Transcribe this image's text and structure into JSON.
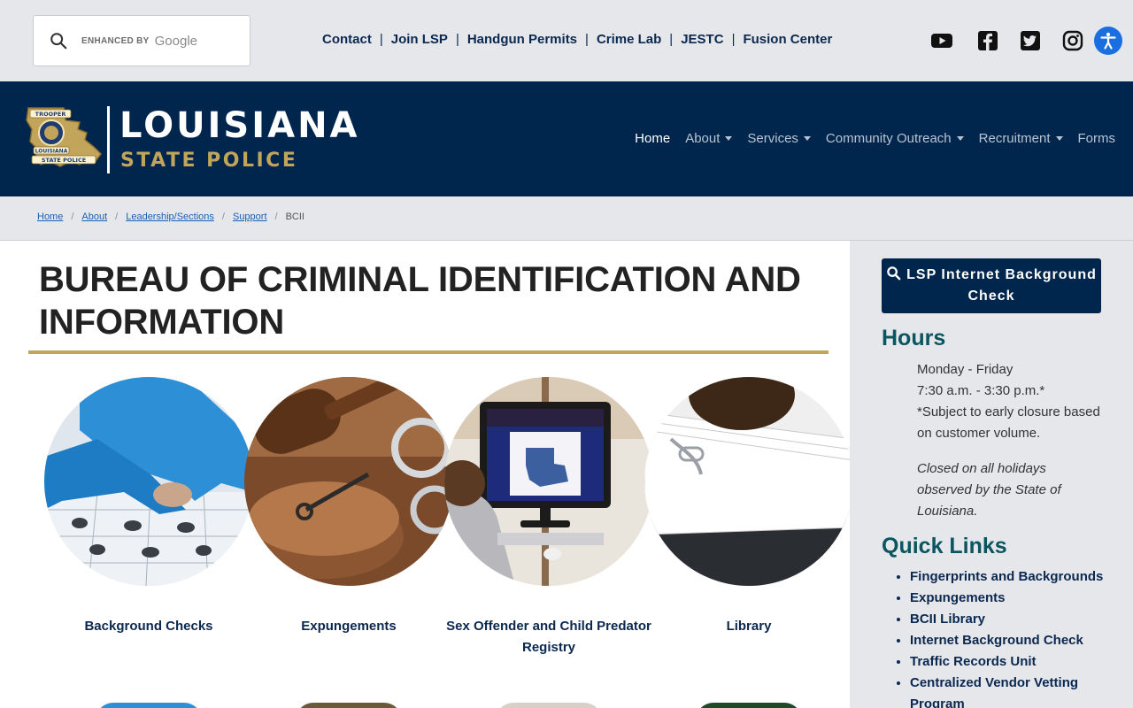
{
  "search": {
    "enhanced_label": "ENHANCED BY",
    "google_label": "Google"
  },
  "utility_nav": [
    {
      "label": "Contact"
    },
    {
      "label": "Join LSP"
    },
    {
      "label": "Handgun Permits"
    },
    {
      "label": "Crime Lab"
    },
    {
      "label": "JESTC"
    },
    {
      "label": "Fusion Center"
    }
  ],
  "utility_separator": "|",
  "social_icons": [
    "youtube-icon",
    "facebook-icon",
    "twitter-icon",
    "instagram-icon"
  ],
  "accessibility_icon": "accessibility-icon",
  "logo": {
    "badge_line1": "TROOPER",
    "badge_line2": "LOUISIANA",
    "badge_line3": "STATE POLICE",
    "line1": "LOUISIANA",
    "line2": "STATE POLICE"
  },
  "main_nav": [
    {
      "label": "Home",
      "active": true,
      "dropdown": false
    },
    {
      "label": "About",
      "active": false,
      "dropdown": true
    },
    {
      "label": "Services",
      "active": false,
      "dropdown": true
    },
    {
      "label": "Community Outreach",
      "active": false,
      "dropdown": true
    },
    {
      "label": "Recruitment",
      "active": false,
      "dropdown": true
    },
    {
      "label": "Forms",
      "active": false,
      "dropdown": false
    }
  ],
  "breadcrumb": {
    "items": [
      "Home",
      "About",
      "Leadership/Sections",
      "Support"
    ],
    "current": "BCII",
    "separator": "/"
  },
  "page": {
    "title": "BUREAU OF CRIMINAL IDENTIFICATION AND INFORMATION"
  },
  "tiles": [
    {
      "label": "Background Checks"
    },
    {
      "label": "Expungements"
    },
    {
      "label": "Sex Offender and Child Predator Registry"
    },
    {
      "label": "Library"
    }
  ],
  "sidebar": {
    "cta_label": "LSP Internet Background Check",
    "hours_heading": "Hours",
    "hours_lines": [
      "Monday - Friday",
      "7:30 a.m. - 3:30 p.m.*",
      "*Subject to early closure based on customer volume."
    ],
    "holiday_note": "Closed on all holidays observed by the State of Louisiana.",
    "quick_links_heading": "Quick Links",
    "quick_links": [
      "Fingerprints and Backgrounds",
      "Expungements",
      "BCII Library",
      "Internet Background Check",
      "Traffic Records Unit",
      "Centralized Vendor Vetting Program"
    ]
  },
  "colors": {
    "navy": "#00264d",
    "gold": "#c2a45a",
    "teal_heading": "#0b5560",
    "link": "#0b2850",
    "accessibility_blue": "#1a6fe0"
  }
}
